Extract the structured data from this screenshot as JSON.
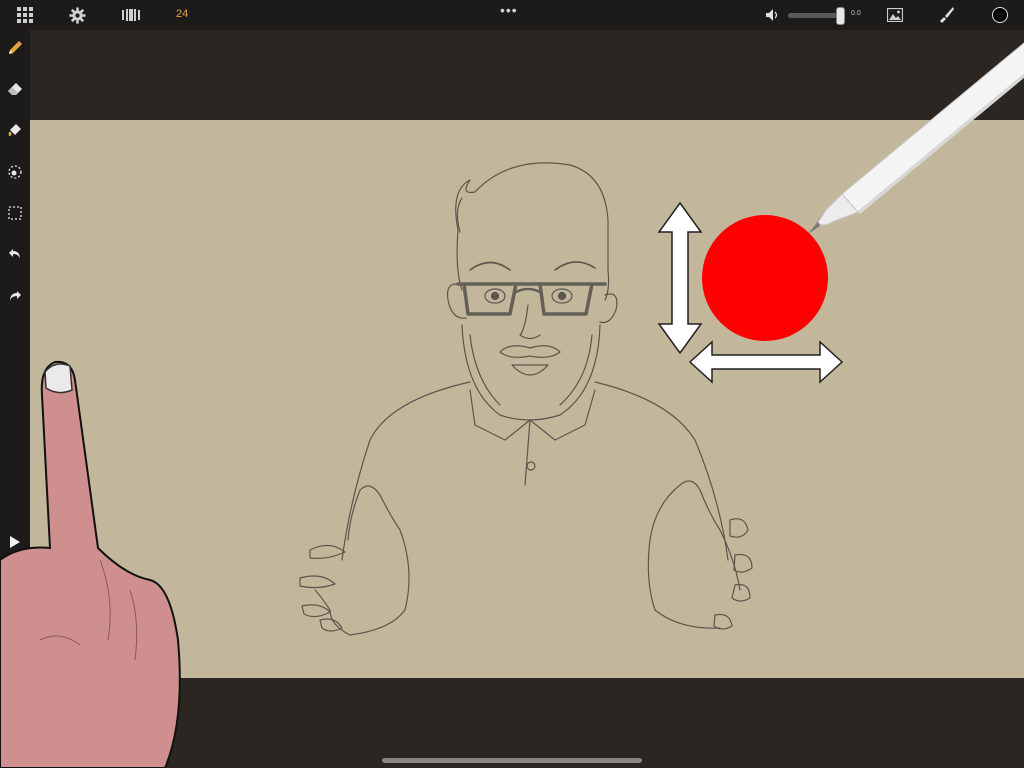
{
  "topbar": {
    "frame_rate": "24",
    "more_menu": "•••",
    "volume_value": "0.0",
    "current_color": "#000000"
  },
  "sidebar": {
    "tools": [
      "pencil-icon",
      "eraser-icon",
      "fill-icon",
      "lasso-icon",
      "selection-icon",
      "undo-icon",
      "redo-icon"
    ],
    "play_icon": "play-icon"
  },
  "canvas": {
    "background": "#c3b79b"
  },
  "overlays": {
    "indicator_color": "#ff0000"
  }
}
